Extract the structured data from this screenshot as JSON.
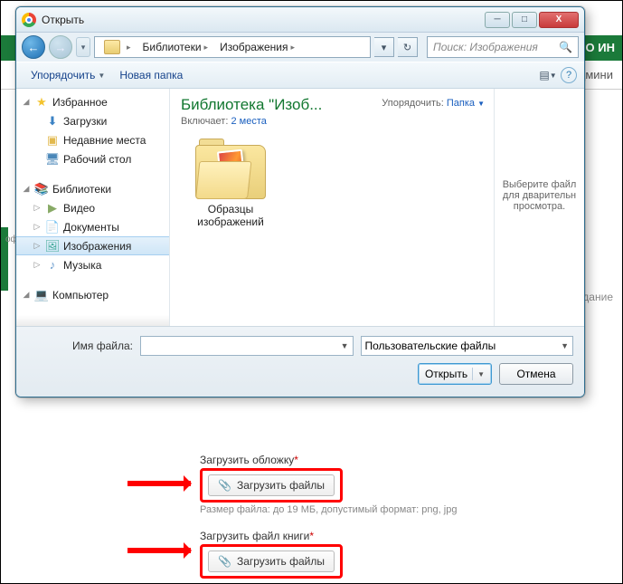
{
  "window": {
    "title": "Открыть",
    "min": "─",
    "max": "□",
    "close": "X"
  },
  "nav": {
    "back": "←",
    "fwd": "→",
    "drop": "▾",
    "path_seg1": "Библиотеки",
    "path_seg2": "Изображения",
    "refresh": "↻",
    "search_placeholder": "Поиск: Изображения"
  },
  "toolbar": {
    "organize": "Упорядочить",
    "newfolder": "Новая папка",
    "help": "?"
  },
  "tree": {
    "favorites": "Избранное",
    "downloads": "Загрузки",
    "recent": "Недавние места",
    "desktop": "Рабочий стол",
    "libraries": "Библиотеки",
    "videos": "Видео",
    "documents": "Документы",
    "pictures": "Изображения",
    "music": "Музыка",
    "computer": "Компьютер"
  },
  "content": {
    "lib_title": "Библиотека \"Изоб...",
    "includes": "Включает:",
    "places": "2 места",
    "arrange_label": "Упорядочить:",
    "arrange_value": "Папка",
    "folder_name": "Образцы изображений"
  },
  "preview": {
    "text": "Выберите файл для дварительн просмотра."
  },
  "footer": {
    "filename_label": "Имя файла:",
    "filter": "Пользовательские файлы",
    "open": "Открыть",
    "cancel": "Отмена"
  },
  "bg": {
    "right1": "ПОО ИН",
    "right2": "Админи",
    "right3": "е издание",
    "left1": "оф\nнзи\n\nуз\n\nст"
  },
  "form": {
    "cover_label": "Загрузить обложку",
    "upload_btn": "Загрузить файлы",
    "cover_hint": "Размер файла: до 19 МБ, допустимый формат: png, jpg",
    "book_label": "Загрузить файл книги"
  }
}
